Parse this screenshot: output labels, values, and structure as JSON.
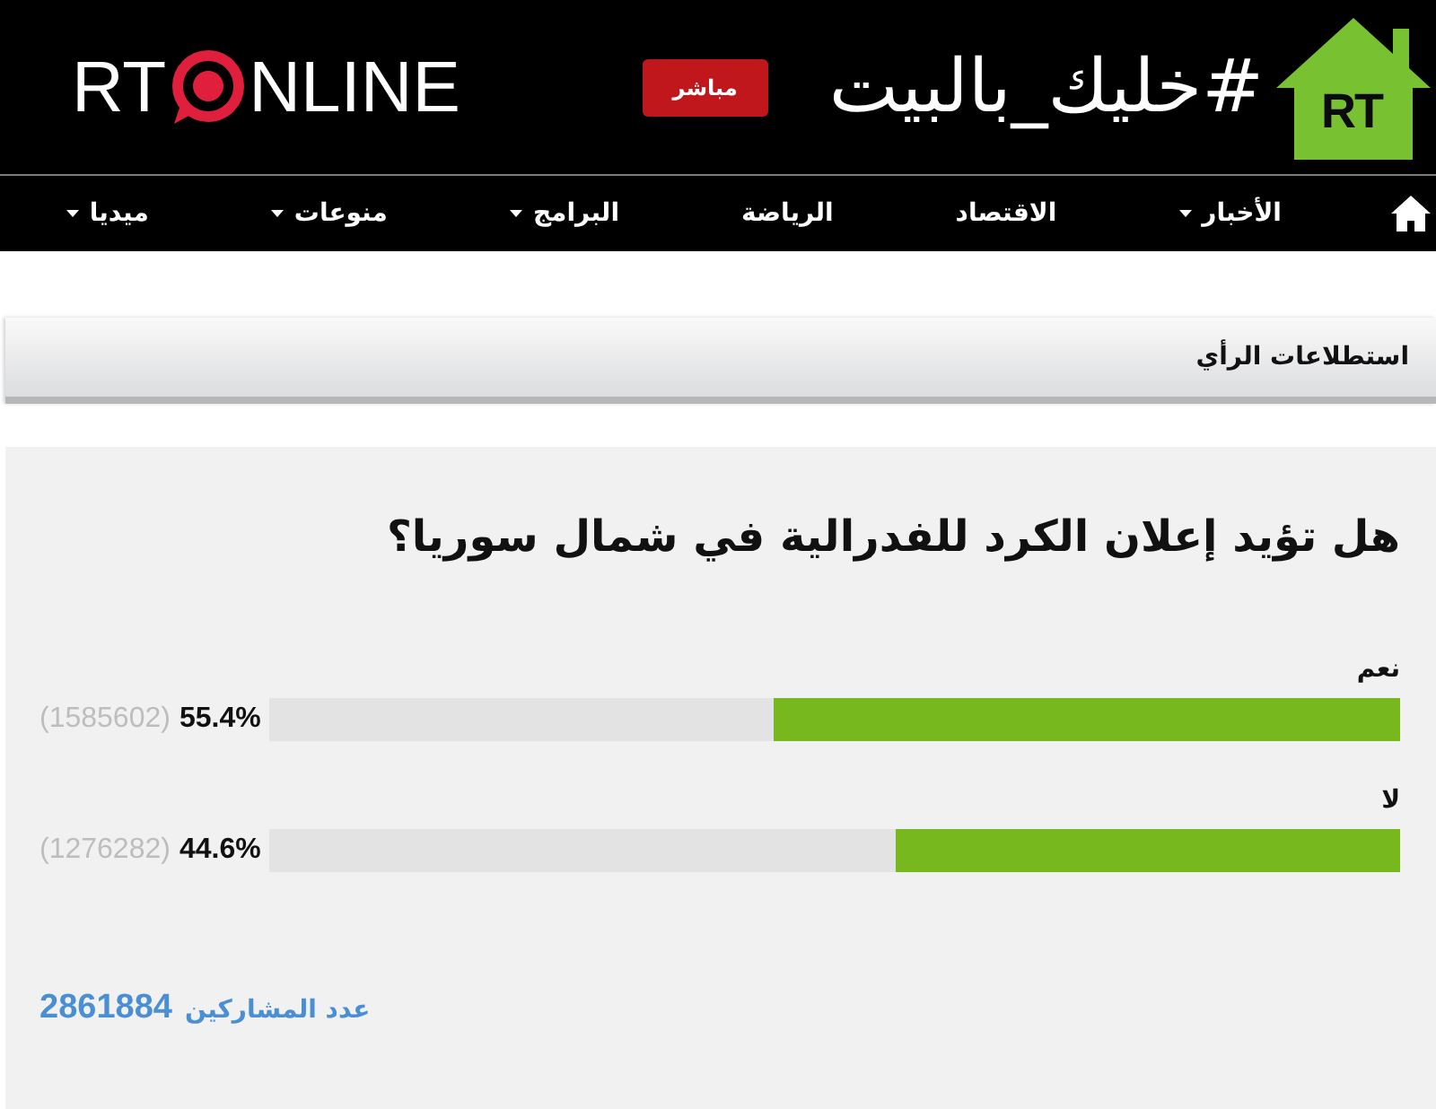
{
  "header": {
    "logo": {
      "text_before_mark": "RT",
      "text_after_mark": "NLINE"
    },
    "live_button": "مباشر",
    "hashtag": "#خليك_بالبيت",
    "house_logo": "RT"
  },
  "nav": {
    "items": [
      {
        "label": "الأخبار",
        "dropdown": true
      },
      {
        "label": "الاقتصاد",
        "dropdown": false
      },
      {
        "label": "الرياضة",
        "dropdown": false
      },
      {
        "label": "البرامج",
        "dropdown": true
      },
      {
        "label": "منوعات",
        "dropdown": true
      },
      {
        "label": "ميديا",
        "dropdown": true
      }
    ]
  },
  "section": {
    "title": "استطلاعات الرأي"
  },
  "poll": {
    "question": "هل تؤيد إعلان الكرد للفدرالية في شمال سوريا؟",
    "options": [
      {
        "label": "نعم",
        "votes": "(1585602)",
        "percent": "55.4%",
        "level": 0.554
      },
      {
        "label": "لا",
        "votes": "(1276282)",
        "percent": "44.6%",
        "level": 0.446
      }
    ],
    "participants_label": "عدد المشاركين",
    "participants_count": "2861884"
  }
}
